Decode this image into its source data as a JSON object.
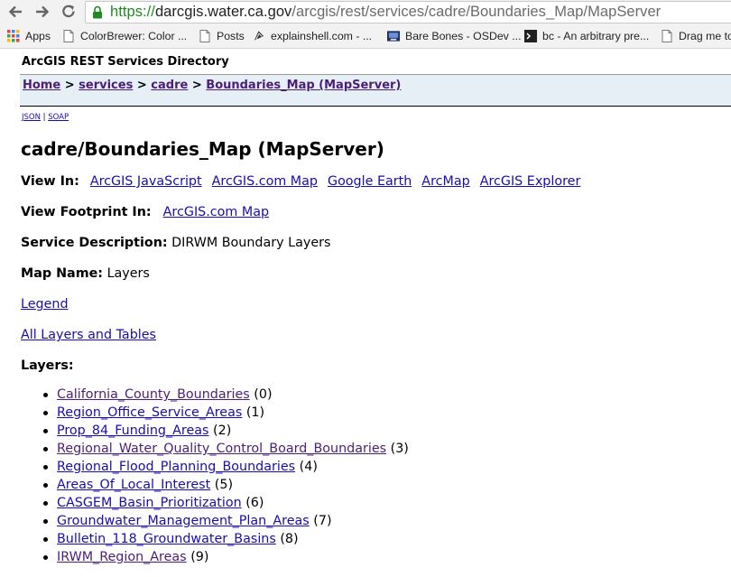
{
  "browser": {
    "url_scheme": "https://",
    "url_host": "darcgis.water.ca.gov",
    "url_path": "/arcgis/rest/services/cadre/Boundaries_Map/MapServer",
    "bookmarks": [
      {
        "label": "Apps",
        "icon": "apps-grid-icon"
      },
      {
        "label": "ColorBrewer: Color ...",
        "icon": "page-icon"
      },
      {
        "label": "Posts",
        "icon": "page-icon"
      },
      {
        "label": "explainshell.com - ...",
        "icon": "shell-icon"
      },
      {
        "label": "Bare Bones - OSDev ...",
        "icon": "osdev-icon"
      },
      {
        "label": "bc - An arbitrary pre...",
        "icon": "bc-icon"
      },
      {
        "label": "Drag me to",
        "icon": "page-icon"
      }
    ]
  },
  "page": {
    "directory_title": "ArcGIS REST Services Directory",
    "breadcrumb": {
      "home": "Home",
      "sep": ">",
      "services": "services",
      "cadre": "cadre",
      "current": "Boundaries_Map (MapServer)"
    },
    "formats": {
      "json": "JSON",
      "sep": "|",
      "soap": "SOAP"
    },
    "service_title": "cadre/Boundaries_Map (MapServer)",
    "view_in": {
      "label": "View In:",
      "links": [
        "ArcGIS JavaScript",
        "ArcGIS.com Map",
        "Google Earth",
        "ArcMap",
        "ArcGIS Explorer"
      ]
    },
    "view_footprint": {
      "label": "View Footprint In:",
      "link": "ArcGIS.com Map"
    },
    "service_description": {
      "label": "Service Description:",
      "value": "DIRWM Boundary Layers"
    },
    "map_name": {
      "label": "Map Name:",
      "value": "Layers"
    },
    "legend_link": "Legend",
    "all_layers_link": "All Layers and Tables",
    "layers_label": "Layers:",
    "layers": [
      {
        "name": "California_County_Boundaries",
        "id": "(0)"
      },
      {
        "name": "Region_Office_Service_Areas",
        "id": "(1)"
      },
      {
        "name": "Prop_84_Funding_Areas",
        "id": "(2)"
      },
      {
        "name": "Regional_Water_Quality_Control_Board_Boundaries",
        "id": "(3)"
      },
      {
        "name": "Regional_Flood_Planning_Boundaries",
        "id": "(4)"
      },
      {
        "name": "Areas_Of_Local_Interest",
        "id": "(5)"
      },
      {
        "name": "CASGEM_Basin_Prioritization",
        "id": "(6)"
      },
      {
        "name": "Groundwater_Management_Plan_Areas",
        "id": "(7)"
      },
      {
        "name": "Bulletin_118_Groundwater_Basins",
        "id": "(8)"
      },
      {
        "name": "IRWM_Region_Areas",
        "id": "(9)"
      }
    ]
  },
  "colors": {
    "link_unvisited": "#1a0dab",
    "link_visited": "#4b1e78",
    "breadcrumb_bg": "#e5eff5",
    "url_secure": "#1f8a1f"
  }
}
